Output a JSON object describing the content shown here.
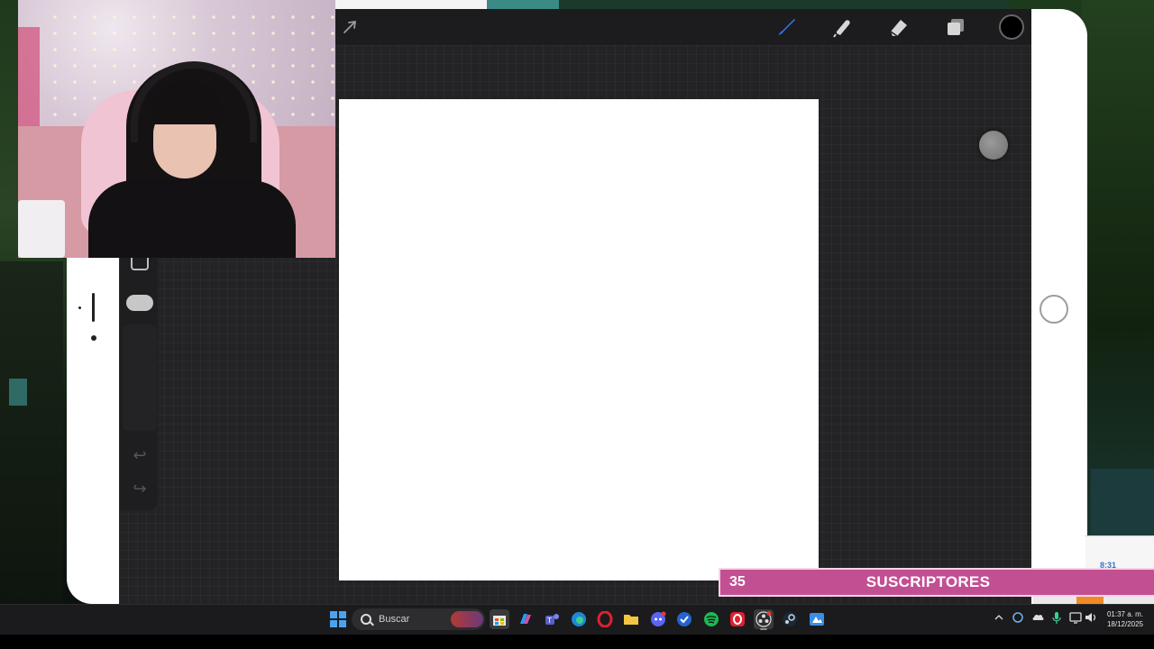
{
  "toolbar": {
    "icons": [
      "actions-arrow-icon",
      "brush-icon",
      "smudge-icon",
      "eraser-icon",
      "layers-icon",
      "color-swatch"
    ],
    "color_swatch_hex": "#000000",
    "brush_accent_hex": "#2f7cf6"
  },
  "sidebar": {
    "icons": [
      "modify-square-icon",
      "size-slider",
      "opacity-slider",
      "undo-icon",
      "redo-icon"
    ]
  },
  "subscriber_bar": {
    "count": "35",
    "label": "SUSCRIPTORES",
    "color_hex": "#c34f93"
  },
  "taskbar": {
    "search_label": "Buscar",
    "apps": [
      "start-icon",
      "search-box",
      "store-icon",
      "copilot-icon",
      "teams-icon",
      "edge-icon",
      "opera-icon",
      "files-icon",
      "discord-icon",
      "todo-icon",
      "spotify-icon",
      "opera-gx-icon",
      "obs-icon",
      "steam-icon",
      "sidecar-icon"
    ],
    "clock": {
      "time": "01:37 a. m.",
      "date": "18/12/2025"
    }
  },
  "right_window": {
    "text": "8:31"
  }
}
